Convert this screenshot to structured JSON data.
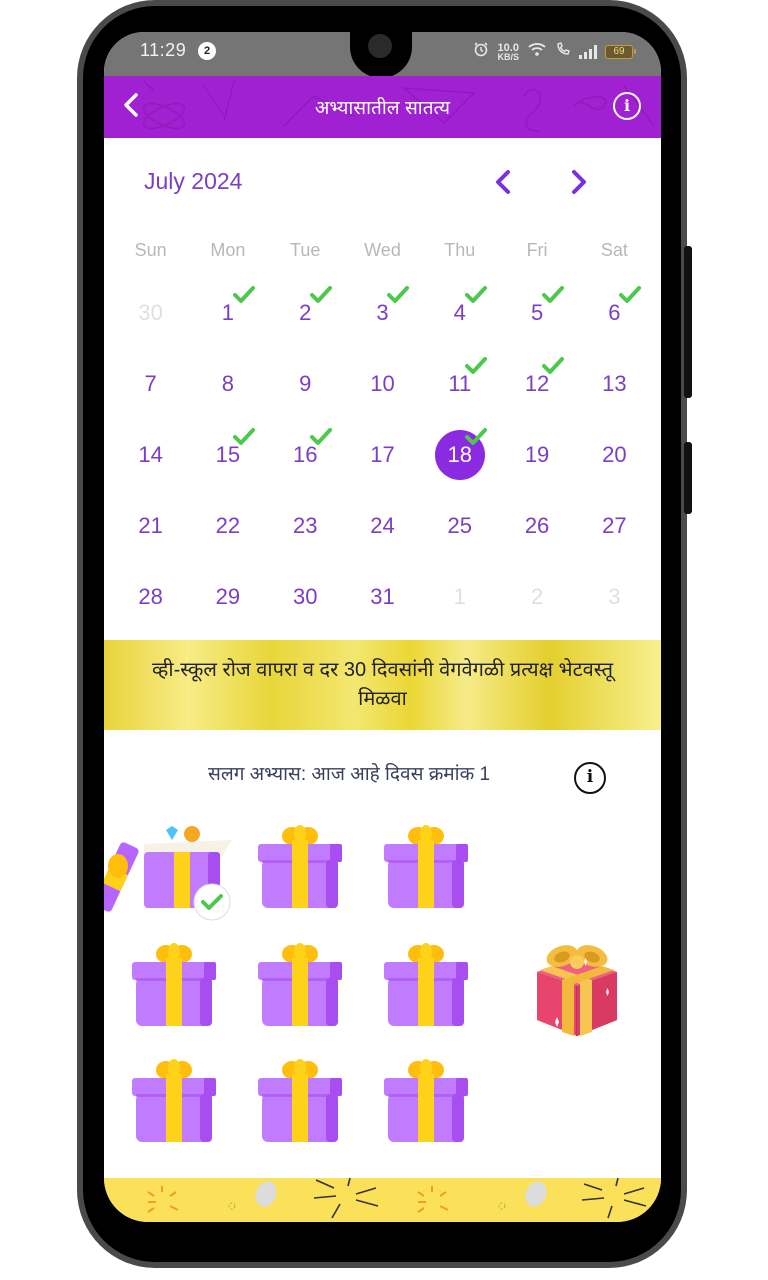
{
  "status_bar": {
    "time": "11:29",
    "notification_count": "2",
    "net_speed_value": "10.0",
    "net_speed_unit": "KB/S",
    "battery": "69",
    "icons": [
      "alarm-icon",
      "wifi-icon",
      "wifi-calling-icon",
      "signal-icon",
      "battery-icon"
    ]
  },
  "header": {
    "back_icon": "chevron-left-icon",
    "title": "अभ्यासातील सातत्य",
    "info_icon": "info-icon",
    "background_color": "#a021d1"
  },
  "calendar": {
    "month_label": "July 2024",
    "prev_icon": "chevron-left-icon",
    "next_icon": "chevron-right-icon",
    "weekdays": [
      "Sun",
      "Mon",
      "Tue",
      "Wed",
      "Thu",
      "Fri",
      "Sat"
    ],
    "accent_color": "#8a2be2",
    "check_color": "#4cc94c",
    "days": [
      {
        "label": "30",
        "muted": true,
        "checked": false
      },
      {
        "label": "1",
        "muted": false,
        "checked": true
      },
      {
        "label": "2",
        "muted": false,
        "checked": true
      },
      {
        "label": "3",
        "muted": false,
        "checked": true
      },
      {
        "label": "4",
        "muted": false,
        "checked": true
      },
      {
        "label": "5",
        "muted": false,
        "checked": true
      },
      {
        "label": "6",
        "muted": false,
        "checked": true
      },
      {
        "label": "7",
        "muted": false,
        "checked": false
      },
      {
        "label": "8",
        "muted": false,
        "checked": false
      },
      {
        "label": "9",
        "muted": false,
        "checked": false
      },
      {
        "label": "10",
        "muted": false,
        "checked": false
      },
      {
        "label": "11",
        "muted": false,
        "checked": true
      },
      {
        "label": "12",
        "muted": false,
        "checked": true
      },
      {
        "label": "13",
        "muted": false,
        "checked": false
      },
      {
        "label": "14",
        "muted": false,
        "checked": false
      },
      {
        "label": "15",
        "muted": false,
        "checked": true
      },
      {
        "label": "16",
        "muted": false,
        "checked": true
      },
      {
        "label": "17",
        "muted": false,
        "checked": false
      },
      {
        "label": "18",
        "muted": false,
        "checked": true,
        "today": true
      },
      {
        "label": "19",
        "muted": false,
        "checked": false
      },
      {
        "label": "20",
        "muted": false,
        "checked": false
      },
      {
        "label": "21",
        "muted": false,
        "checked": false
      },
      {
        "label": "22",
        "muted": false,
        "checked": false
      },
      {
        "label": "23",
        "muted": false,
        "checked": false
      },
      {
        "label": "24",
        "muted": false,
        "checked": false
      },
      {
        "label": "25",
        "muted": false,
        "checked": false
      },
      {
        "label": "26",
        "muted": false,
        "checked": false
      },
      {
        "label": "27",
        "muted": false,
        "checked": false
      },
      {
        "label": "28",
        "muted": false,
        "checked": false
      },
      {
        "label": "29",
        "muted": false,
        "checked": false
      },
      {
        "label": "30",
        "muted": false,
        "checked": false
      },
      {
        "label": "31",
        "muted": false,
        "checked": false
      },
      {
        "label": "1",
        "muted": true,
        "checked": false
      },
      {
        "label": "2",
        "muted": true,
        "checked": false
      },
      {
        "label": "3",
        "muted": true,
        "checked": false
      }
    ]
  },
  "banner": {
    "text": "व्ही-स्कूल रोज वापरा व दर 30 दिवसांनी वेगवेगळी प्रत्यक्ष भेटवस्तू मिळवा"
  },
  "streak": {
    "text": "सलग अभ्यास: आज आहे दिवस क्रमांक 1",
    "info_icon": "info-icon"
  },
  "rewards": {
    "gifts": [
      {
        "state": "opened",
        "claimed": true
      },
      {
        "state": "closed",
        "claimed": false
      },
      {
        "state": "closed",
        "claimed": false
      },
      {
        "state": "closed",
        "claimed": false
      },
      {
        "state": "closed",
        "claimed": false
      },
      {
        "state": "closed",
        "claimed": false
      },
      {
        "state": "closed",
        "claimed": false
      },
      {
        "state": "closed",
        "claimed": false
      },
      {
        "state": "closed",
        "claimed": false
      }
    ],
    "grand_prize_icon": "big-gift-icon",
    "gift_color": "#c17bff",
    "ribbon_color": "#ffd21a"
  }
}
